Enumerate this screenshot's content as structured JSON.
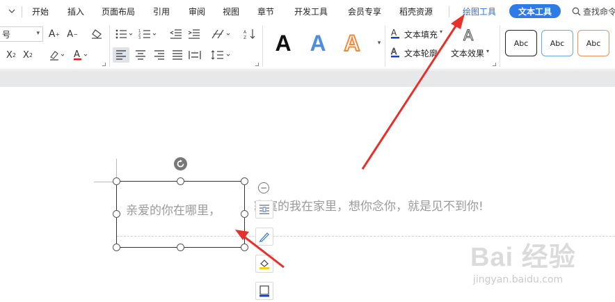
{
  "menubar": {
    "tabs": [
      {
        "label": "开始"
      },
      {
        "label": "插入"
      },
      {
        "label": "页面布局"
      },
      {
        "label": "引用"
      },
      {
        "label": "审阅"
      },
      {
        "label": "视图"
      },
      {
        "label": "章节"
      },
      {
        "label": "开发工具"
      },
      {
        "label": "会员专享"
      },
      {
        "label": "稻壳资源"
      },
      {
        "label": "绘图工具"
      }
    ],
    "active_tab": "文本工具",
    "search_label": "查找命令"
  },
  "ribbon": {
    "font_size_value": "号",
    "text_fill_label": "文本填充",
    "text_outline_label": "文本轮廓",
    "text_effect_label": "文本效果",
    "style_samples": [
      "Abc",
      "Abc",
      "Abc"
    ],
    "art_letters": [
      "A",
      "A",
      "A"
    ],
    "colors": {
      "accent_blue": "#2f7be6",
      "art_blue": "#4f8fd8",
      "art_orange": "#ef8a3c",
      "style_orange": "#e8935a",
      "arrow_red": "#e8302a"
    }
  },
  "document": {
    "textbox_text": "亲爱的你在哪里，",
    "body_text": "寂寞的我在家里，想你念你，就是见不到你!",
    "selection_chrome": "textbox selected with rotate handle and eight resize handles"
  },
  "watermark": {
    "brand": "Bai 经验",
    "url": "jingyan.baidu.com"
  }
}
